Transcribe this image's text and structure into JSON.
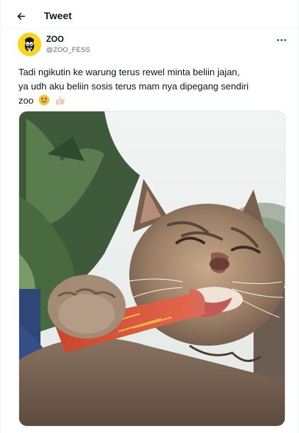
{
  "header": {
    "title": "Tweet",
    "back_icon": "arrow-left-icon"
  },
  "author": {
    "name": "ZOO",
    "handle": "@ZOO_FESS",
    "avatar_color": "#f6d51e"
  },
  "tweet": {
    "lines": [
      "Tadi ngikutin ke warung terus rewel minta beliin jajan,",
      "ya udh aku beliin sosis terus mam nya dipegang sendiri",
      "zoo"
    ],
    "emojis": [
      "grinning-face-icon",
      "thumbs-up-icon"
    ]
  },
  "media": {
    "kind": "photo",
    "subject": "cat-eating-sausage"
  },
  "colors": {
    "text": "#0f1419",
    "secondary": "#536471",
    "border": "#eff3f4"
  }
}
